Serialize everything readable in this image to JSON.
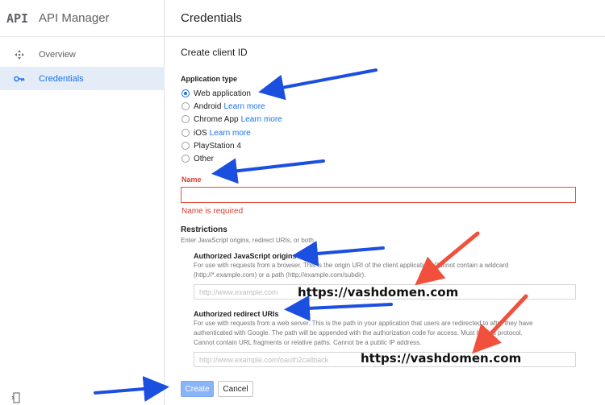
{
  "sidebar": {
    "logo": "API",
    "title": "API Manager",
    "items": [
      {
        "label": "Overview",
        "icon": "overview-icon"
      },
      {
        "label": "Credentials",
        "icon": "key-icon"
      }
    ]
  },
  "header": {
    "title": "Credentials"
  },
  "form": {
    "section_title": "Create client ID",
    "app_type_label": "Application type",
    "options": [
      {
        "label": "Web application",
        "link": "",
        "selected": true
      },
      {
        "label": "Android",
        "link": "Learn more",
        "selected": false
      },
      {
        "label": "Chrome App",
        "link": "Learn more",
        "selected": false
      },
      {
        "label": "iOS",
        "link": "Learn more",
        "selected": false
      },
      {
        "label": "PlayStation 4",
        "link": "",
        "selected": false
      },
      {
        "label": "Other",
        "link": "",
        "selected": false
      }
    ],
    "name_label": "Name",
    "name_value": "",
    "name_error": "Name is required",
    "restrictions_title": "Restrictions",
    "restrictions_sub": "Enter JavaScript origins, redirect URIs, or both",
    "js_origins": {
      "label": "Authorized JavaScript origins",
      "help_1": "For use with requests from a browser. This is the origin URI of the client application. Cannot contain a wildcard",
      "help_2": "(http://*.example.com) or a path (http://example.com/subdir).",
      "placeholder": "http://www.example.com"
    },
    "redirect_uris": {
      "label": "Authorized redirect URIs",
      "help_1": "For use with requests from a web server. This is the path in your application that users are redirected to after they have",
      "help_2": "authenticated with Google. The path will be appended with the authorization code for access. Must have a protocol.",
      "help_3": "Cannot contain URL fragments or relative paths. Cannot be a public IP address.",
      "placeholder": "http://www.example.com/oauth2callback"
    },
    "create_label": "Create",
    "cancel_label": "Cancel"
  },
  "annotations": {
    "origin_text": "https://vashdomen.com",
    "redirect_text": "https://vashdomen.com",
    "blue_arrow_color": "#1a4fe0",
    "red_arrow_color": "#f0503c"
  },
  "colors": {
    "accent": "#1a73e8",
    "error": "#d23f31",
    "active_nav_bg": "#e3ecf7"
  }
}
